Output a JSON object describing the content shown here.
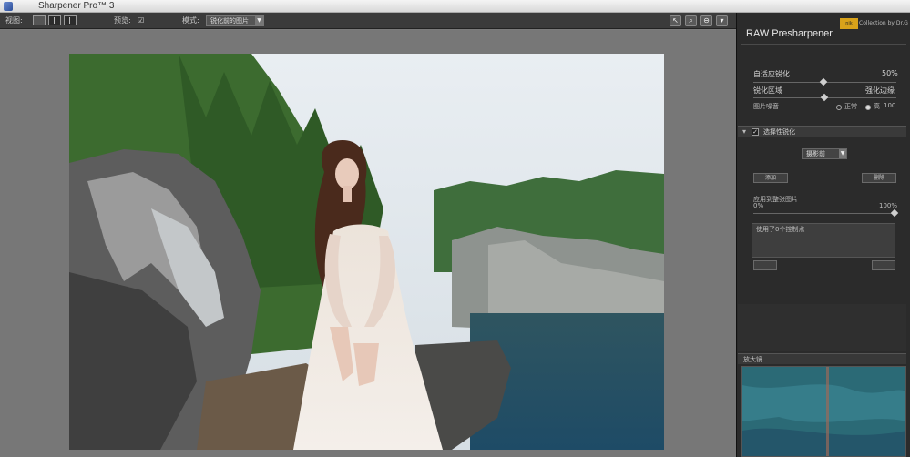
{
  "window": {
    "title": "Sharpener Pro™ 3"
  },
  "toolbar": {
    "view_label": "视图:",
    "preview_label": "预览:",
    "mode_label": "模式:",
    "mode_value": "锐化前的图片"
  },
  "panel": {
    "brand_badge": "nik",
    "brand_text": "Collection by Dr.G",
    "title": "RAW Presharpener",
    "adaptive_label": "自适应锐化",
    "adaptive_value": "50%",
    "adaptive_level": 0.5,
    "area_left_label": "锐化区域",
    "area_right_label": "强化边缘",
    "image_noise_label": "图片噪音",
    "radio_normal_label": "正常",
    "radio_high_label": "高",
    "radio_high_value": "100",
    "section_title": "选择性锐化",
    "section_select": "摄影前",
    "left_button": "添加",
    "right_button": "删除",
    "apply_label": "应用到整张图片",
    "range_min": "0%",
    "range_max": "100%",
    "apply_level": 1.0,
    "list_text": "使用了0个控制点",
    "list_btn_left": "",
    "list_btn_right": "",
    "loupe_title": "放大镜"
  },
  "colors": {
    "accent": "#d8a21a",
    "panel_bg": "#2b2b2b",
    "canvas_bg": "#777777"
  }
}
